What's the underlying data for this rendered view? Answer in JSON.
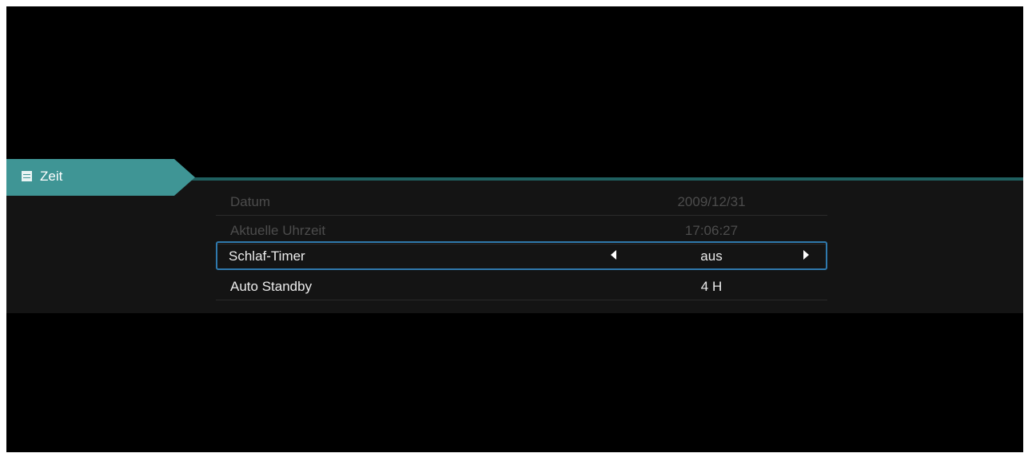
{
  "category": {
    "label": "Zeit",
    "icon": "list-icon",
    "color": "#3f9595"
  },
  "settings": [
    {
      "label": "Datum",
      "value": "2009/12/31",
      "state": "disabled"
    },
    {
      "label": "Aktuelle Uhrzeit",
      "value": "17:06:27",
      "state": "disabled"
    },
    {
      "label": "Schlaf-Timer",
      "value": "aus",
      "state": "selected"
    },
    {
      "label": "Auto Standby",
      "value": "4 H",
      "state": "enabled"
    }
  ],
  "colors": {
    "background": "#000000",
    "panel": "#141414",
    "selection_border": "#2f79ad",
    "disabled_text": "#4c4c4c",
    "active_text": "#ececec"
  }
}
